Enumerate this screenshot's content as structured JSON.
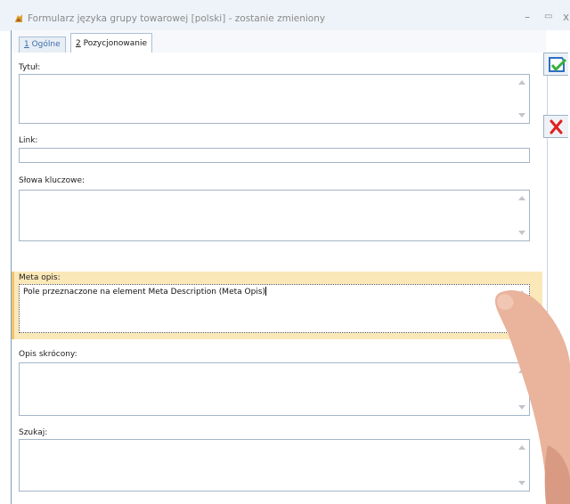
{
  "window": {
    "title": "Formularz języka grupy towarowej [polski] - zostanie zmieniony",
    "minimize_glyph": "–",
    "maximize_glyph": "▭",
    "close_glyph": "x"
  },
  "tabs": [
    {
      "hotkey": "1",
      "label": " Ogólne",
      "active": false
    },
    {
      "hotkey": "2",
      "label": " Pozycjonowanie",
      "active": true
    }
  ],
  "fields": {
    "tytul": {
      "label": "Tytuł:",
      "value": ""
    },
    "link": {
      "label": "Link:",
      "value": ""
    },
    "slowa": {
      "label": "Słowa kluczowe:",
      "value": ""
    },
    "meta": {
      "label": "Meta opis:",
      "value": "Pole przeznaczone na element Meta Description (Meta Opis)"
    },
    "opis": {
      "label": "Opis skrócony:",
      "value": ""
    },
    "szukaj": {
      "label": "Szukaj:",
      "value": ""
    }
  },
  "side_buttons": {
    "save_icon": "save-check-icon",
    "cancel_icon": "red-x-icon"
  },
  "colors": {
    "highlight": "#fbe8b8",
    "tab_text": "#3a6da8",
    "cancel_red": "#e02020",
    "save_blue": "#2d6fc4",
    "save_green": "#3cae3c"
  }
}
